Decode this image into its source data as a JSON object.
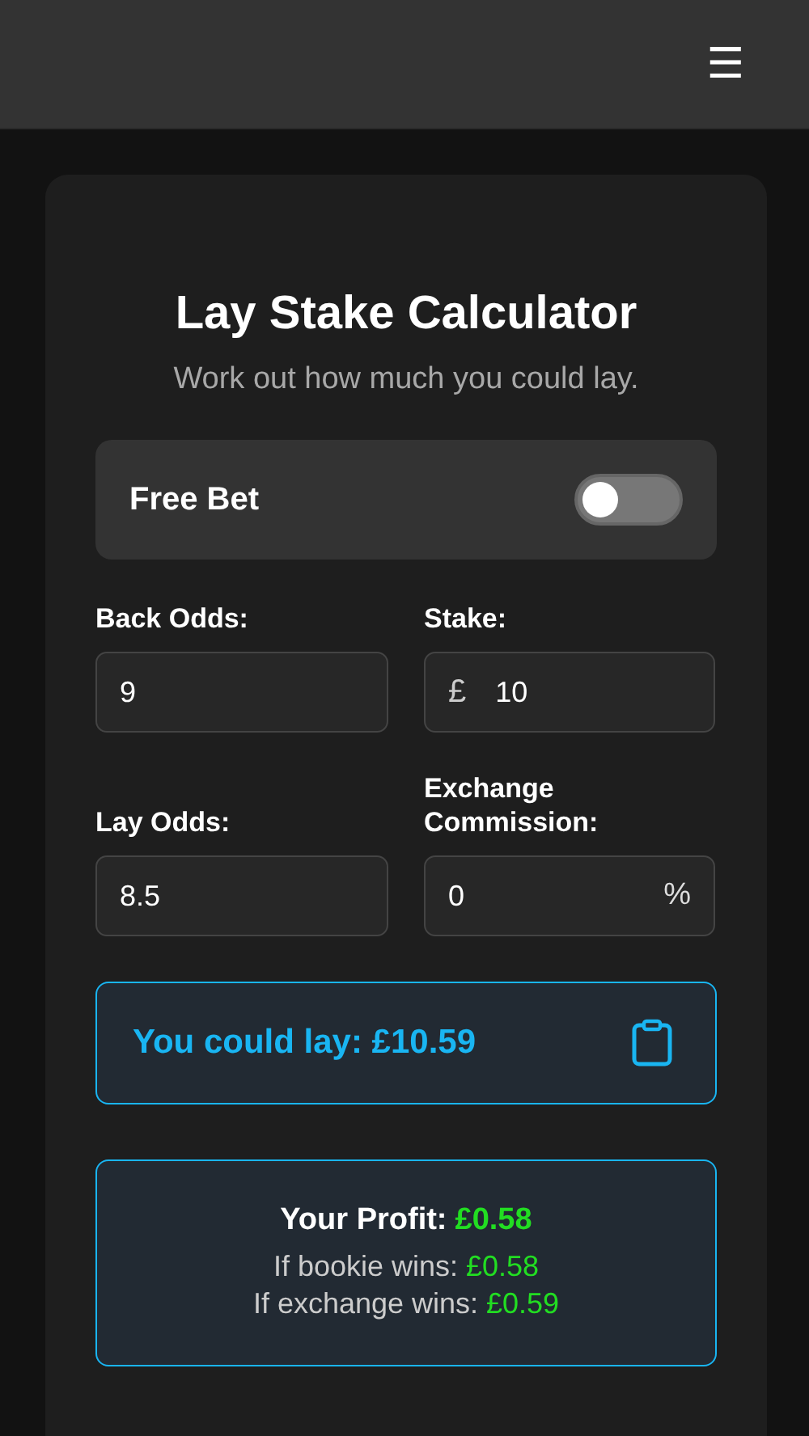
{
  "header": {
    "menu_icon": "☰"
  },
  "title": "Lay Stake Calculator",
  "subtitle": "Work out how much you could lay.",
  "free_bet": {
    "label": "Free Bet",
    "on": false
  },
  "field_rows": [
    [
      {
        "label": "Back Odds:",
        "value": "9"
      },
      {
        "label": "Stake:",
        "prefix": "£",
        "value": "10"
      }
    ],
    [
      {
        "label": "Lay Odds:",
        "value": "8.5"
      },
      {
        "label": "Exchange Commission:",
        "value": "0",
        "suffix": "%"
      }
    ]
  ],
  "result": {
    "text": "You could lay: £10.59"
  },
  "profit": {
    "label": "Your Profit:",
    "value": "£0.58",
    "lines": [
      {
        "label": "If bookie wins:",
        "value": "£0.58"
      },
      {
        "label": "If exchange wins:",
        "value": "£0.59"
      }
    ]
  }
}
